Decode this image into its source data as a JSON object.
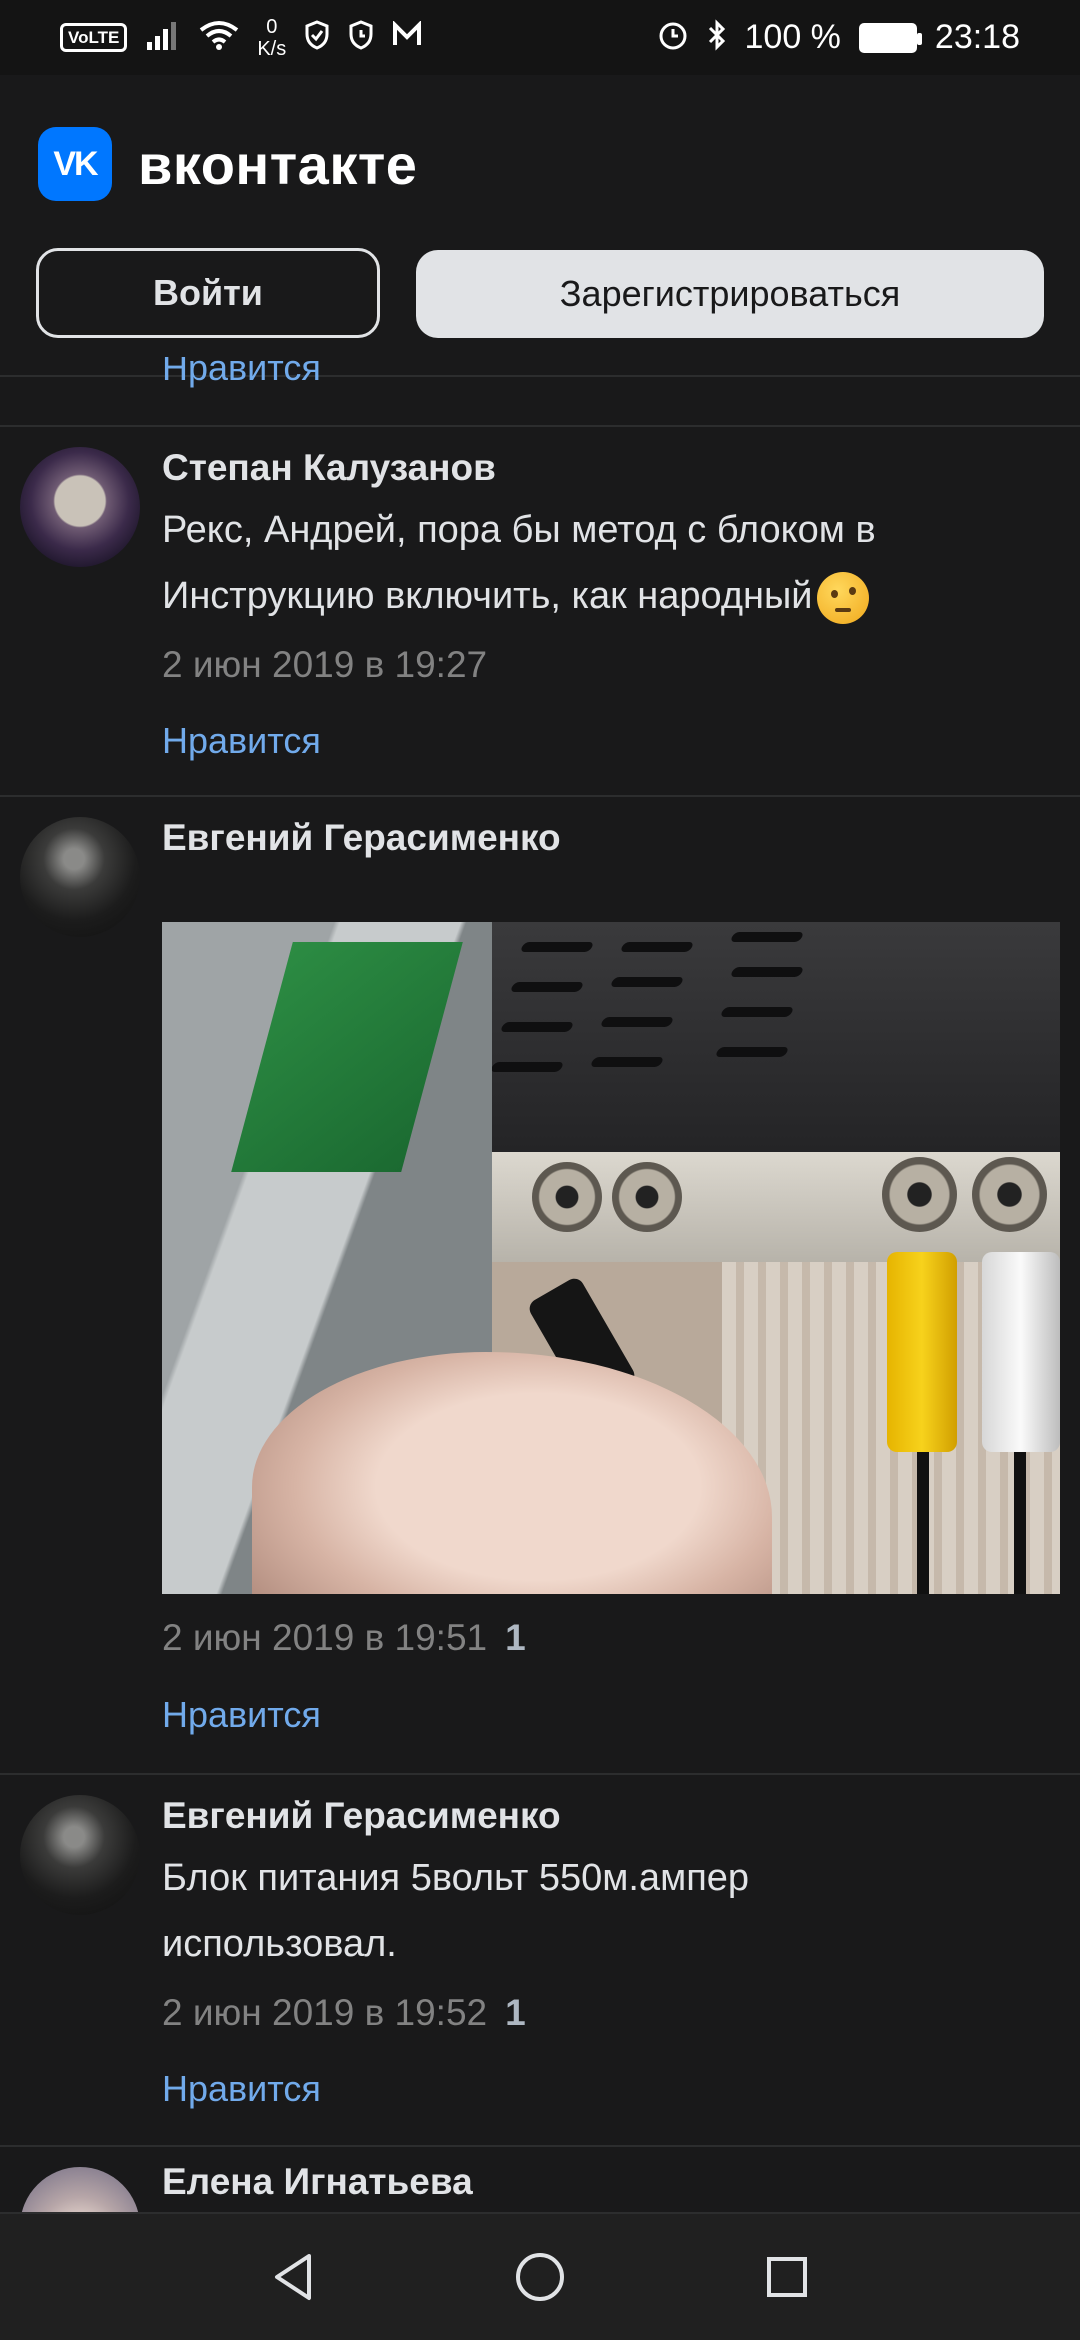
{
  "status_bar": {
    "volte": "VoLTE",
    "speed_value": "0",
    "speed_unit": "K/s",
    "battery": "100 %",
    "time": "23:18"
  },
  "header": {
    "brand": "вконтакте",
    "logo_text": "VK",
    "login_label": "Войти",
    "register_label": "Зарегистрироваться",
    "accent_color": "#0077ff"
  },
  "partial_like": "Нравится",
  "comments": [
    {
      "author": "Степан Калузанов",
      "text_line1": "Рекс, Андрей, пора бы метод с блоком в",
      "text_line2": "Инструкцию включить, как народный",
      "emoji": "thinking-face-emoji",
      "date": "2 июн 2019 в 19:27",
      "like": "Нравится"
    },
    {
      "author": "Евгений Герасименко",
      "photo": "tv-receiver-power-plug-photo",
      "date": "2 июн 2019 в 19:51",
      "likes_count": "1",
      "like": "Нравится"
    },
    {
      "author": "Евгений Герасименко",
      "text_line1": "Блок питания 5вольт 550м.ампер",
      "text_line2": "использовал.",
      "date": "2 июн 2019 в 19:52",
      "likes_count": "1",
      "like": "Нравится"
    },
    {
      "author": "Елена Игнатьева"
    }
  ],
  "nav_bar": {
    "back": "back-icon",
    "home": "home-icon",
    "recents": "recents-icon"
  }
}
